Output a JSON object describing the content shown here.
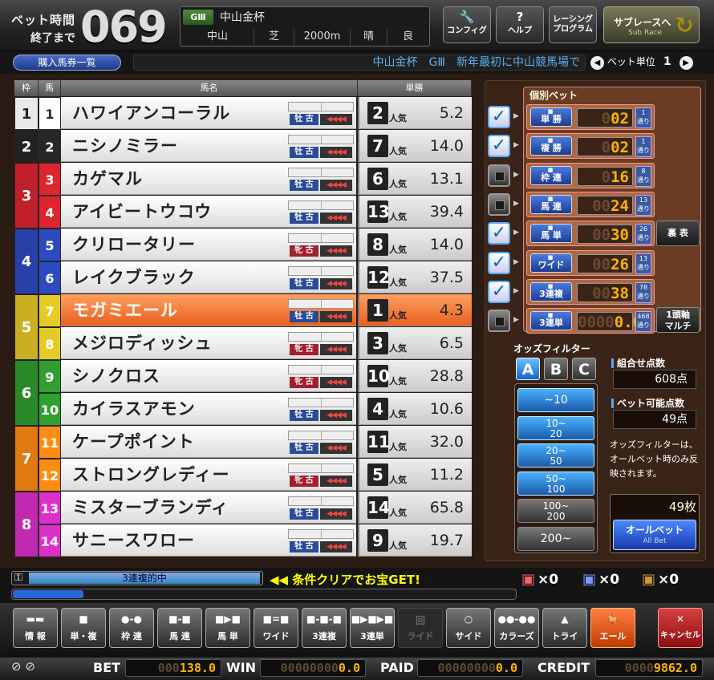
{
  "header": {
    "bet_time_label1": "ベット時間",
    "bet_time_label2": "終了まで",
    "bet_time_value": "069",
    "grade": "GⅢ",
    "race_name": "中山金杯",
    "venue": "中山",
    "surface": "芝",
    "distance": "2000m",
    "weather": "晴",
    "track": "良",
    "buttons": [
      {
        "label": "コンフィグ",
        "icon": "wrench"
      },
      {
        "label": "ヘルプ",
        "icon": "?"
      },
      {
        "label": "レーシング\nプログラム",
        "icon": ""
      }
    ],
    "subrace": {
      "label": "サブレースへ",
      "sub": "Sub Race"
    }
  },
  "bar2": {
    "list_button": "購入馬券一覧",
    "ticker": "中山金杯　GⅢ　新年最初に中山競馬場で",
    "unit_label": "ベット単位",
    "unit_value": "1"
  },
  "table": {
    "headers": {
      "waku": "枠",
      "uma": "馬",
      "name": "馬名",
      "win": "単勝"
    },
    "popularity_suffix": "人気",
    "horses": [
      {
        "waku": 1,
        "uma": 1,
        "name": "ハワイアンコーラル",
        "sex": "牡 古",
        "pop": 2,
        "odds": "5.2",
        "arrows": "◀◀◀◀"
      },
      {
        "waku": 2,
        "uma": 2,
        "name": "ニシノミラー",
        "sex": "牡 古",
        "pop": 7,
        "odds": "14.0",
        "arrows": "◀◀◀◀"
      },
      {
        "waku": 3,
        "uma": 3,
        "name": "カゲマル",
        "sex": "牡 古",
        "pop": 6,
        "odds": "13.1",
        "arrows": "◀◀◀◀"
      },
      {
        "waku": 3,
        "uma": 4,
        "name": "アイビートウコウ",
        "sex": "牡 古",
        "pop": 13,
        "odds": "39.4",
        "arrows": "◀◀◀◀"
      },
      {
        "waku": 4,
        "uma": 5,
        "name": "クリロータリー",
        "sex": "牝 古",
        "pop": 8,
        "odds": "14.0",
        "arrows": "◀◀◀◀"
      },
      {
        "waku": 4,
        "uma": 6,
        "name": "レイクブラック",
        "sex": "牡 古",
        "pop": 12,
        "odds": "37.5",
        "arrows": "◀◀◀◀"
      },
      {
        "waku": 5,
        "uma": 7,
        "name": "モガミエール",
        "sex": "牡 古",
        "pop": 1,
        "odds": "4.3",
        "arrows": "◀◀◀◀",
        "selected": true
      },
      {
        "waku": 5,
        "uma": 8,
        "name": "メジロディッシュ",
        "sex": "牝 古",
        "pop": 3,
        "odds": "6.5",
        "arrows": "◀◀◀◀"
      },
      {
        "waku": 6,
        "uma": 9,
        "name": "シノクロス",
        "sex": "牝 古",
        "pop": 10,
        "odds": "28.8",
        "arrows": "◀◀◀◀"
      },
      {
        "waku": 6,
        "uma": 10,
        "name": "カイラスアモン",
        "sex": "牡 古",
        "pop": 4,
        "odds": "10.6",
        "arrows": "◀◀◀◀"
      },
      {
        "waku": 7,
        "uma": 11,
        "name": "ケープポイント",
        "sex": "牡 古",
        "pop": 11,
        "odds": "32.0",
        "arrows": "◀◀◀◀"
      },
      {
        "waku": 7,
        "uma": 12,
        "name": "ストロングレディー",
        "sex": "牝 古",
        "pop": 5,
        "odds": "11.2",
        "arrows": "◀◀◀◀"
      },
      {
        "waku": 8,
        "uma": 13,
        "name": "ミスターブランディ",
        "sex": "牡 古",
        "pop": 14,
        "odds": "65.8",
        "arrows": "◀◀◀◀"
      },
      {
        "waku": 8,
        "uma": 14,
        "name": "サニースワロー",
        "sex": "牡 古",
        "pop": 9,
        "odds": "19.7",
        "arrows": "◀◀◀◀"
      }
    ]
  },
  "individual_bet": {
    "title": "個別ベット",
    "rows": [
      {
        "label": "単 勝",
        "checked": true,
        "dim": "0",
        "value": "02",
        "tr": "1\n通り"
      },
      {
        "label": "複 勝",
        "checked": true,
        "dim": "0",
        "value": "02",
        "tr": "1\n通り"
      },
      {
        "label": "枠 連",
        "checked": false,
        "dim": "0",
        "value": "16",
        "tr": "8\n通り"
      },
      {
        "label": "馬 連",
        "checked": false,
        "dim": "00",
        "value": "24",
        "tr": "13\n通り"
      },
      {
        "label": "馬 単",
        "checked": true,
        "dim": "00",
        "value": "30",
        "tr": "26\n通り"
      },
      {
        "label": "ワイド",
        "checked": true,
        "dim": "00",
        "value": "26",
        "tr": "13\n通り"
      },
      {
        "label": "3連複",
        "checked": true,
        "dim": "00",
        "value": "38",
        "tr": "78\n通り"
      },
      {
        "label": "3連単",
        "checked": false,
        "dim": "0000",
        "value": "0.0",
        "tr": "468\n通り"
      }
    ],
    "side_buttons": {
      "ura": "裏 表",
      "ichi": "1頭軸\nマルチ"
    }
  },
  "odds_filter": {
    "title": "オッズフィルター",
    "tabs": [
      "A",
      "B",
      "C"
    ],
    "active_tab": "A",
    "ranges": [
      {
        "label": "~10",
        "active": true
      },
      {
        "label": "10~\n20",
        "active": true
      },
      {
        "label": "20~\n50",
        "active": true
      },
      {
        "label": "50~\n100",
        "active": true
      },
      {
        "label": "100~\n200",
        "active": false
      },
      {
        "label": "200~",
        "active": false
      }
    ]
  },
  "summary": {
    "combo_label": "組合せ点数",
    "combo_value": "608点",
    "bettable_label": "ベット可能点数",
    "bettable_value": "49点",
    "note": "オッズフィルターは、オールベット時のみ反映されます。",
    "count": "49枚",
    "allbet": "オールベット",
    "allbet_sub": "All Bet"
  },
  "status": {
    "hit_text": "3連複的中",
    "clear_text": "◀◀ 条件クリアでお宝GET!",
    "treasures": [
      {
        "count": "×0"
      },
      {
        "count": "×0"
      },
      {
        "count": "×0"
      }
    ],
    "progress": 0.14
  },
  "bottom_buttons": [
    {
      "label": "情 報",
      "glyph": "▬▬"
    },
    {
      "label": "単・複",
      "glyph": "■"
    },
    {
      "label": "枠 連",
      "glyph": "●-●"
    },
    {
      "label": "馬 連",
      "glyph": "■-■"
    },
    {
      "label": "馬 単",
      "glyph": "■▶■"
    },
    {
      "label": "ワイド",
      "glyph": "■=■"
    },
    {
      "label": "3連複",
      "glyph": "■-■-■"
    },
    {
      "label": "3連単",
      "glyph": "■▶■▶■"
    },
    {
      "label": "ライド",
      "glyph": "回",
      "disabled": true
    },
    {
      "label": "サイド",
      "glyph": "○"
    },
    {
      "label": "カラーズ",
      "glyph": "●●-●●"
    },
    {
      "label": "トライ",
      "glyph": "▲"
    },
    {
      "label": "エール",
      "glyph": "🐎",
      "active": true
    },
    {
      "label": "キャンセル",
      "glyph": "✕",
      "cancel": true
    }
  ],
  "footer": {
    "bet_label": "BET",
    "bet_dim": "000",
    "bet_value": "138.0",
    "win_label": "WIN",
    "win_dim": "00000000",
    "win_value": "0.0",
    "paid_label": "PAID",
    "paid_dim": "00000000",
    "paid_value": "0.0",
    "credit_label": "CREDIT",
    "credit_dim": "0000",
    "credit_value": "9862.0"
  },
  "colors": {
    "waku": {
      "1": "#e8e8e8",
      "2": "#222222",
      "3": "#c0202a",
      "4": "#2840a8",
      "5": "#c8b020",
      "6": "#2a8a2a",
      "7": "#e07a10",
      "8": "#c02ab0"
    },
    "accent": "#ffb400",
    "selected": "#f07030"
  }
}
